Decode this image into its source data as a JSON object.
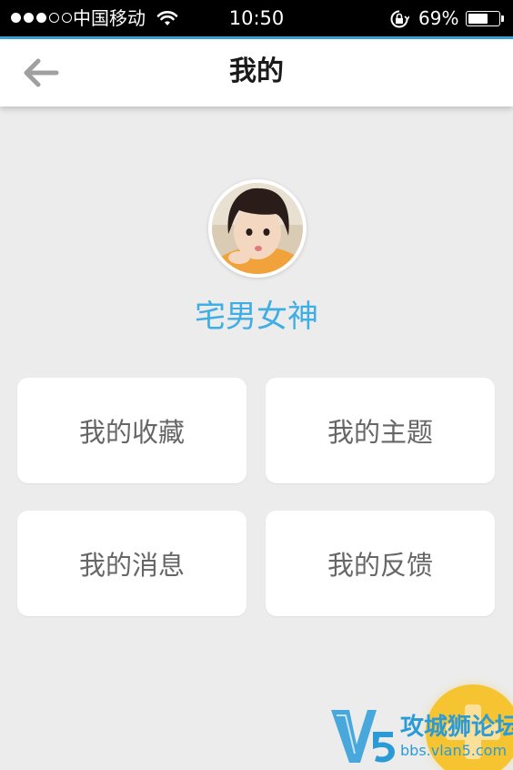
{
  "status_bar": {
    "carrier": "中国移动",
    "time": "10:50",
    "battery_percent": "69%",
    "battery_level": 0.69,
    "signal_bars_filled": 3,
    "signal_bars_total": 5
  },
  "nav": {
    "title": "我的",
    "back_icon": "arrow-left-icon"
  },
  "profile": {
    "username": "宅男女神",
    "avatar_icon": "user-avatar"
  },
  "menu": {
    "items": [
      {
        "label": "我的收藏"
      },
      {
        "label": "我的主题"
      },
      {
        "label": "我的消息"
      },
      {
        "label": "我的反馈"
      }
    ]
  },
  "fab": {
    "icon": "plus-icon"
  },
  "watermark": {
    "name": "攻城狮论坛",
    "url": "bbs.vlan5.com"
  },
  "colors": {
    "accent": "#3aa3da",
    "username": "#3eaee4",
    "fab": "#f7c431",
    "background": "#ececec"
  }
}
